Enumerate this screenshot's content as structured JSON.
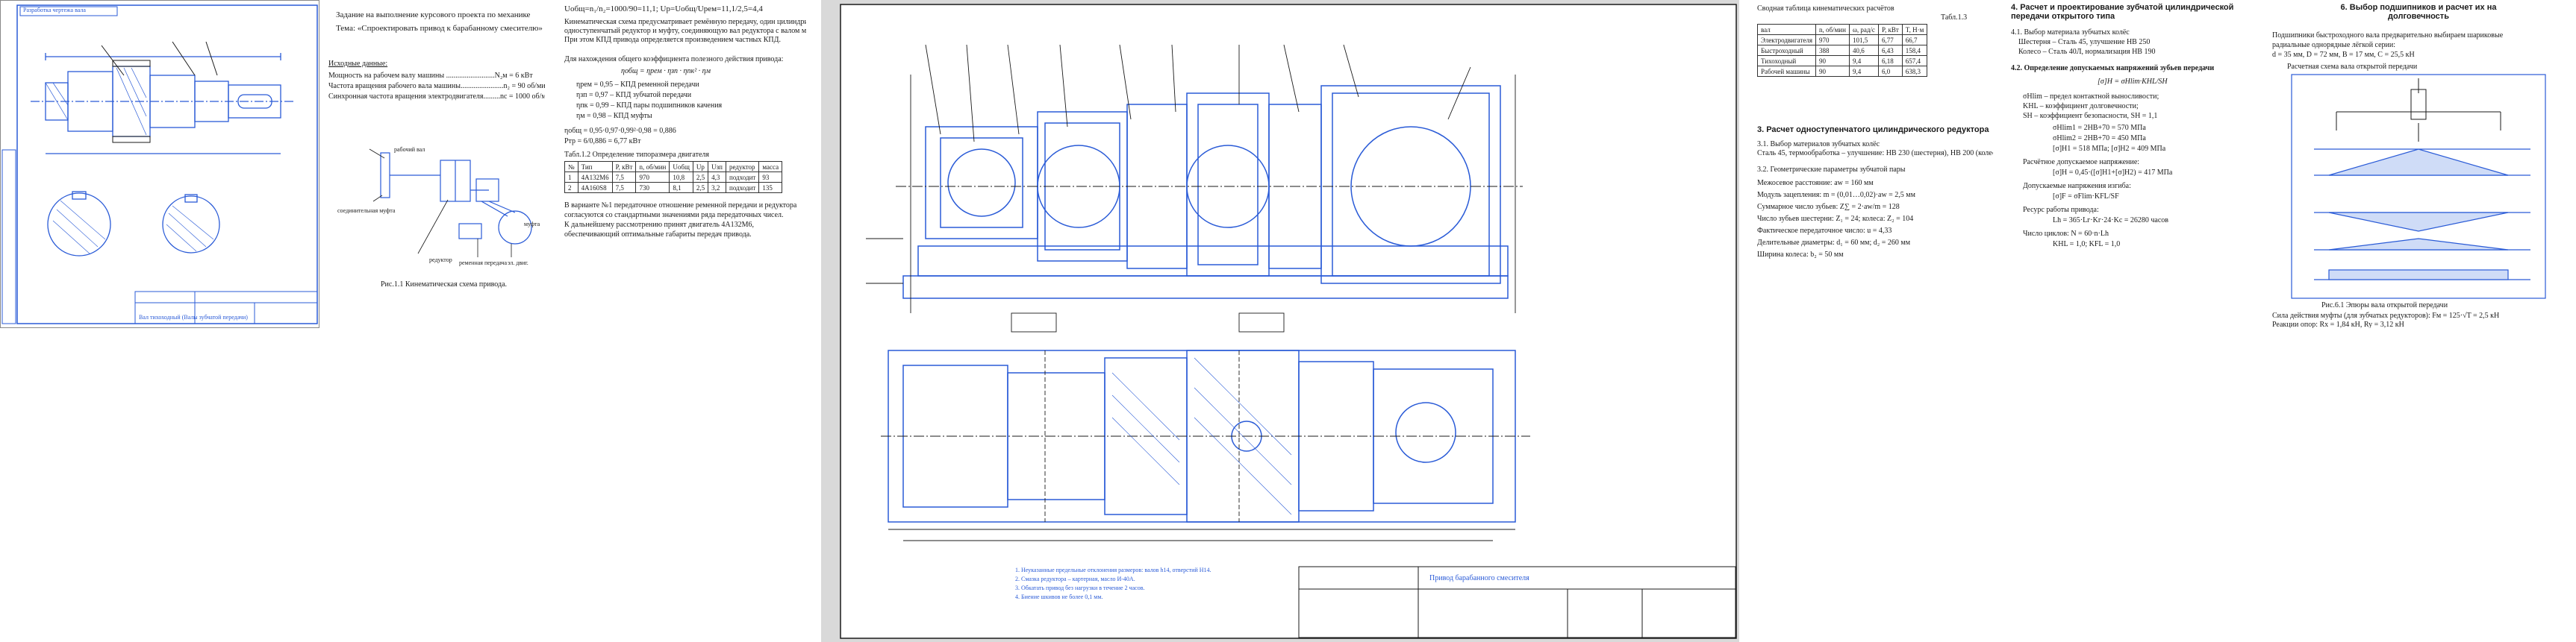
{
  "sheet1": {
    "stamp": "Разработка чертежа вала",
    "footer": "Вал тихоходный (Валы зубчатой передачи)"
  },
  "sheet2": {
    "heading1": "Задание на выполнение курсового проекта по механике",
    "heading2": "Тема: «Спроектировать привод к барабанному смесителю»",
    "given_label": "Исходные данные:",
    "params": [
      "Мощность на рабочем валу машины ..........................N₂м = 6 кВт",
      "Частота вращения рабочего вала машины.......................n₂ = 90 об/мин",
      "Синхронная частота вращения электродвигателя.........nс = 1000 об/мин"
    ],
    "scheme_labels": [
      "рабочий вал",
      "соединительная муфта",
      "редуктор",
      "ременная передача",
      "эл. двиг.",
      "муфта"
    ],
    "caption": "Рис.1.1 Кинематическая схема привода."
  },
  "sheet3": {
    "formula_top": "Uобщ=n₁/n₂=1000/90=11,1;  Uр=Uобщ/Uрем=11,1/2,5=4,4",
    "para1": "Кинематическая схема предусматривает ремённую передачу, один цилиндрический",
    "para1b": "одноступенчатый редуктор и муфту, соединяющую вал редуктора с валом машины.",
    "para1c": "При этом КПД привода определяется произведением частных КПД.",
    "eff_label": "Для нахождения общего коэффициента полезного действия привода:",
    "eff_formula": "ηобщ = ηрем · ηзп · ηпк² · ηм",
    "eff_items": [
      "ηрем = 0,95 – КПД ременной передачи",
      "ηзп = 0,97 – КПД зубчатой передачи",
      "ηпк = 0,99 – КПД пары подшипников качения",
      "ηм = 0,98 – КПД муфты"
    ],
    "result1": "ηобщ = 0,95·0,97·0,99²·0,98 = 0,886",
    "result2": "Pтр = 6/0,886 = 6,77 кВт",
    "table_title": "Табл.1.2 Определение типоразмера двигателя",
    "table_head": [
      "№",
      "Тип",
      "P, кВт",
      "n, об/мин",
      "Uобщ",
      "Uр",
      "Uзп",
      "редуктор",
      "масса"
    ],
    "table_rows": [
      [
        "1",
        "4A132M6",
        "7,5",
        "970",
        "10,8",
        "2,5",
        "4,3",
        "подходит",
        "93"
      ],
      [
        "2",
        "4A160S8",
        "7,5",
        "730",
        "8,1",
        "2,5",
        "3,2",
        "подходит",
        "135"
      ]
    ],
    "para2": "В варианте №1 передаточное отношение ременной передачи и редуктора",
    "para2b": "согласуются со стандартными значениями ряда передаточных чисел.",
    "para2c": "К дальнейшему рассмотрению принят двигатель 4A132M6,",
    "para2d": "обеспечивающий оптимальные габариты передач привода."
  },
  "drawing": {
    "stamp_title": "Привод барабанного смесителя",
    "tech_notes": [
      "1. Неуказанные предельные отклонения размеров: валов h14, отверстий H14.",
      "2. Смазка редуктора – картерная, масло И-40А.",
      "3. Обкатать привод без нагрузки в течение 2 часов.",
      "4. Биение шкивов не более 0,1 мм."
    ]
  },
  "sheet5": {
    "table_caption": "Сводная таблица кинематических расчётов",
    "table_num": "Табл.1.3",
    "head": [
      "вал",
      "n, об/мин",
      "ω, рад/с",
      "P, кВт",
      "T, Н·м"
    ],
    "rows": [
      [
        "Электродвигателя",
        "970",
        "101,5",
        "6,77",
        "66,7"
      ],
      [
        "Быстроходный",
        "388",
        "40,6",
        "6,43",
        "158,4"
      ],
      [
        "Тихоходный",
        "90",
        "9,4",
        "6,18",
        "657,4"
      ],
      [
        "Рабочей машины",
        "90",
        "9,4",
        "6,0",
        "638,3"
      ]
    ],
    "section3": "3. Расчет одноступенчатого цилиндрического редуктора",
    "s31": "3.1. Выбор материалов зубчатых колёс",
    "s31b": "Сталь 45, термообработка – улучшение: HB 230 (шестерня), HB 200 (колесо)",
    "s32": "3.2. Геометрические параметры зубчатой пары",
    "lines": [
      "Межосевое расстояние:   aw = 160 мм",
      "Модуль зацепления:   m = (0,01…0,02)·aw = 2,5 мм",
      "Суммарное число зубьев:   Z∑ = 2·aw/m = 128",
      "Число зубьев шестерни:   Z₁ = 24;   колеса:   Z₂ = 104",
      "Фактическое передаточное число:   u = 4,33",
      "Делительные диаметры:   d₁ = 60 мм;   d₂ = 260 мм",
      "Ширина колеса:   b₂ = 50 мм"
    ]
  },
  "sheet6": {
    "heading": "4. Расчет и проектирование зубчатой цилиндрической передачи открытого типа",
    "s41": "4.1. Выбор материала зубчатых колёс",
    "s41b": "Шестерня – Сталь 45, улучшение HB 250",
    "s41c": "Колесо – Сталь 40Л, нормализация HB 190",
    "s42": "4.2. Определение допускаемых напряжений зубьев передачи",
    "formula": "[σ]H = σHlim·KHL/SH",
    "items": [
      "σHlim – предел контактной выносливости;",
      "KHL – коэффициент долговечности;",
      "SH – коэффициент безопасности, SH = 1,1",
      "σHlim1 = 2HB+70 = 570 МПа",
      "σHlim2 = 2HB+70 = 450 МПа",
      "[σ]H1 = 518 МПа;   [σ]H2 = 409 МПа",
      "Расчётное допускаемое напряжение:",
      "[σ]H = 0,45·([σ]H1+[σ]H2) = 417 МПа",
      "Допускаемые напряжения изгиба:",
      "[σ]F = σFlim·KFL/SF",
      "Ресурс работы привода:",
      "Lh = 365·Lг·Kг·24·Kс = 26280 часов",
      "Число циклов:   N = 60·n·Lh",
      "KHL = 1,0;   KFL = 1,0"
    ]
  },
  "sheet7": {
    "heading": "6. Выбор подшипников и расчет их на долговечность",
    "intro": "Подшипники быстроходного вала предварительно выбираем шариковые",
    "intro2": "радиальные однорядные лёгкой серии:",
    "intro3": "d = 35 мм, D = 72 мм, B = 17 мм, C = 25,5 кН",
    "scheme_title": "Расчетная схема вала открытой передачи",
    "caption": "Рис.6.1 Эпюры вала открытой передачи",
    "concl": "Сила действия муфты (для зубчатых редукторов): Fм = 125·√T = 2,5 кН",
    "concl2": "Реакции опор:   Rx = 1,84 кН,   Ry = 3,12 кН"
  }
}
